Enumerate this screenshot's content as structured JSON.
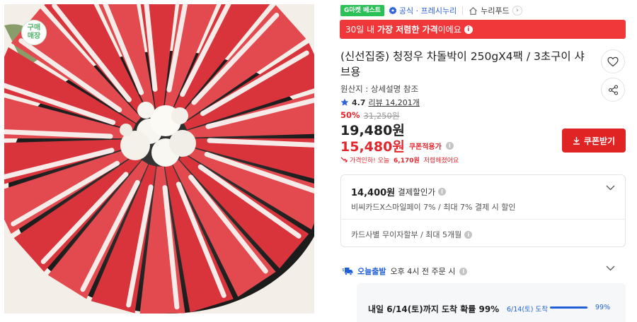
{
  "image": {
    "badge": "구매\n매장",
    "alt": "청정우 차돌박이"
  },
  "tags": {
    "gmarket_best": "G마켓 베스트",
    "official": "공식 · 프레시누리",
    "store": "누리푸드"
  },
  "banner": {
    "prefix": "30일 내 ",
    "highlight": "가장 저렴한 가격",
    "suffix": "이에요"
  },
  "product": {
    "title": "(신선집중) 청정우 차돌박이 250gX4팩 / 3초구이 샤브용",
    "origin": "원산지 : 상세설명 참조",
    "rating": "4.7",
    "review_label": "리뷰 14,201개",
    "discount_rate": "50%",
    "original_price": "31,250원",
    "sale_price": "19,480원",
    "coupon_price": "15,480원",
    "coupon_label": "쿠폰적용가",
    "price_drop_prefix": "가격인하! 오늘 ",
    "price_drop_amount": "6,170원",
    "price_drop_suffix": " 저렴해졌어요"
  },
  "coupon_button": {
    "label": "쿠폰받기"
  },
  "payment": {
    "price": "14,400원",
    "label": "결제할인가",
    "detail": "비씨카드X스마일페이 7% / 최대 7% 결제 시 할인",
    "installment": "카드사별 무이자할부 / 최대 5개월"
  },
  "delivery": {
    "today_label": "오늘출발",
    "cutoff": "오후 4시 전 주문 시",
    "arrival": "내일 6/14(토)까지 도착 확률 99%",
    "date_label": "6/14(토) 도착",
    "probability": 0.99,
    "probability_label": "99%"
  },
  "colors": {
    "accent_red": "#e3262c",
    "banner_red": "#f0383a",
    "brand_green": "#2bc156",
    "link_blue": "#1f5fd8"
  }
}
